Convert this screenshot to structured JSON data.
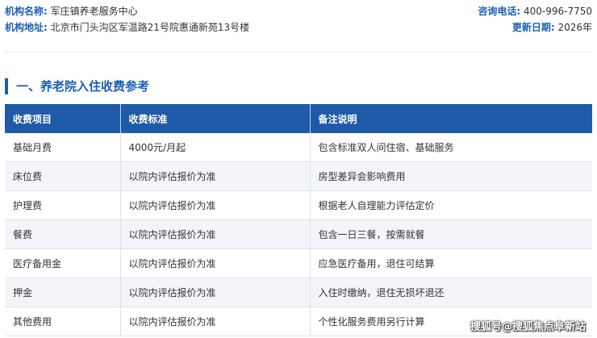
{
  "info": {
    "name_label": "机构名称:",
    "name_value": "军庄镇养老服务中心",
    "phone_label": "咨询电话:",
    "phone_value": "400-996-7750",
    "address_label": "机构地址:",
    "address_value": "北京市门头沟区军温路21号院惠通新苑13号楼",
    "update_label": "更新日期:",
    "update_value": "2026年"
  },
  "section": {
    "title": "一、养老院入住收费参考"
  },
  "table": {
    "headers": [
      "收费项目",
      "收费标准",
      "备注说明"
    ],
    "rows": [
      [
        "基础月费",
        "4000元/月起",
        "包含标准双人间住宿、基础服务"
      ],
      [
        "床位费",
        "以院内评估报价为准",
        "房型差异会影响费用"
      ],
      [
        "护理费",
        "以院内评估报价为准",
        "根据老人自理能力评估定价"
      ],
      [
        "餐费",
        "以院内评估报价为准",
        "包含一日三餐，按需就餐"
      ],
      [
        "医疗备用金",
        "以院内评估报价为准",
        "应急医疗备用，退住可结算"
      ],
      [
        "押金",
        "以院内评估报价为准",
        "入住时缴纳，退住无损坏退还"
      ],
      [
        "其他费用",
        "以院内评估报价为准",
        "个性化服务费用另行计算"
      ]
    ]
  },
  "watermark": "搜狐号@搜狐焦点阜新站"
}
